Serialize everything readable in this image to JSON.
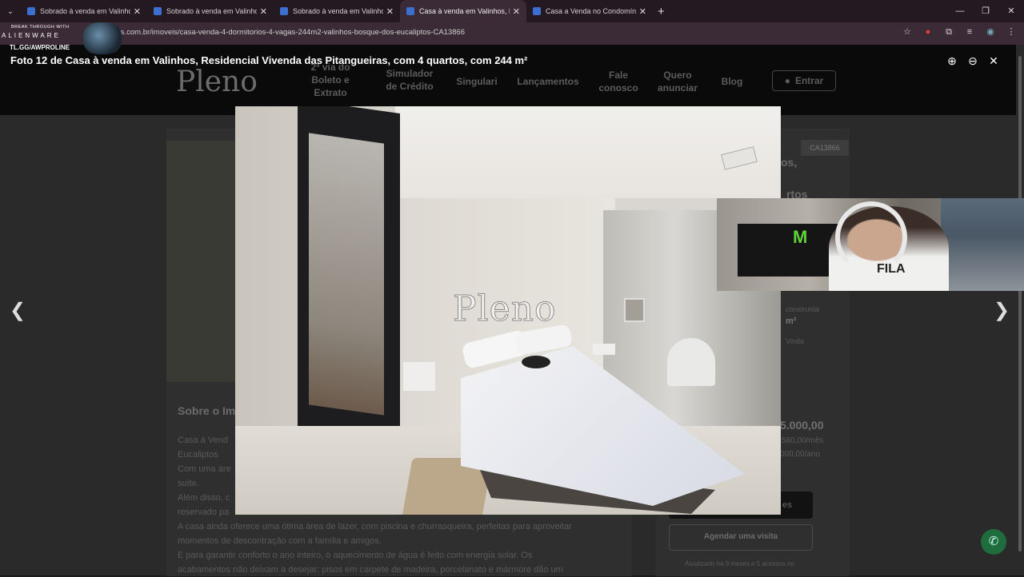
{
  "browser": {
    "tabs": [
      {
        "title": "Sobrado à venda em Valinhos, ",
        "active": false
      },
      {
        "title": "Sobrado à venda em Valinhos, ",
        "active": false
      },
      {
        "title": "Sobrado à venda em Valinhos, ",
        "active": false
      },
      {
        "title": "Casa à venda em Valinhos, Res",
        "active": true
      },
      {
        "title": "Casa a Venda no Condomínio R",
        "active": false
      }
    ],
    "url": "oimoveis.com.br/imoveis/casa-venda-4-dormitorios-4-vagas-244m2-valinhos-bosque-dos-eucaliptos-CA13866"
  },
  "overlay_badge": {
    "line1": "BREAK THROUGH WITH",
    "line2": "ALIENWARE",
    "line3": "TL.GG/AWPROLINE"
  },
  "site": {
    "logo": "Pleno",
    "nav": [
      "2ª via do Boleto e Extrato",
      "Simulador de Crédito",
      "Singulari",
      "Lançamentos",
      "Fale conosco",
      "Quero anunciar",
      "Blog"
    ],
    "login": "Entrar",
    "listing_code": "CA13866",
    "section_title": "Sobre o Im",
    "desc_lines": [
      "Casa à Vend",
      "Eucaliptos",
      "Com uma áre",
      "suíte.",
      "Além disso, c",
      "reservado pa",
      "A casa ainda oferece uma ótima área de lazer, com piscina e churrasqueira, perfeitas para aproveitar",
      "momentos de descontração com a família e amigos.",
      "E para garantir conforto o ano inteiro, o aquecimento de água é feito com energia solar. Os",
      "acabamentos não deixam a desejar: pisos em carpete de madeira, porcelanato e mármore dão um"
    ],
    "right_snippets": [
      "os,",
      "rtos",
      "construída",
      "m²",
      "Vinda"
    ],
    "price": "5.000,00",
    "price_month": "580,00/mês",
    "price_year": "000,00/ano",
    "button_dark": "es",
    "button_visit": "Agendar uma visita",
    "footer_note": "Atualizado há 9 meses e 5 acessos no"
  },
  "lightbox": {
    "title": "Foto 12 de Casa à venda em Valinhos, Residencial Vivenda das Pitangueiras, com 4 quartos, com 244 m²",
    "watermark": "Pleno",
    "controls": [
      "zoom-in",
      "zoom-out",
      "close"
    ]
  },
  "webcam": {
    "brand": "MONSTER",
    "shirt": "FILA"
  }
}
